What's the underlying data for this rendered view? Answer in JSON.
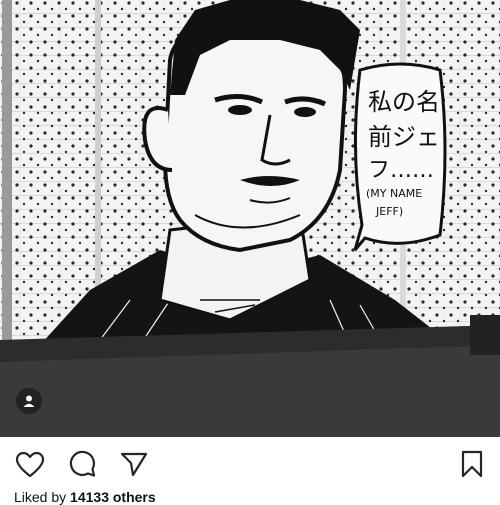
{
  "post": {
    "mural_speech_lines": [
      "私の名",
      "前ジェ",
      "フ……",
      "(MY NAME",
      "JEFF)"
    ],
    "likes_prefix": "Liked by ",
    "likes_count": "14133 others"
  },
  "icons": {
    "like": "heart-icon",
    "comment": "comment-icon",
    "share": "paper-plane-icon",
    "save": "bookmark-icon",
    "tag": "user-tag-icon"
  },
  "colors": {
    "icon_stroke": "#262626",
    "mural_ink": "#111111",
    "wall_white": "#f4f4f4",
    "ground": "#3a3a3a"
  }
}
